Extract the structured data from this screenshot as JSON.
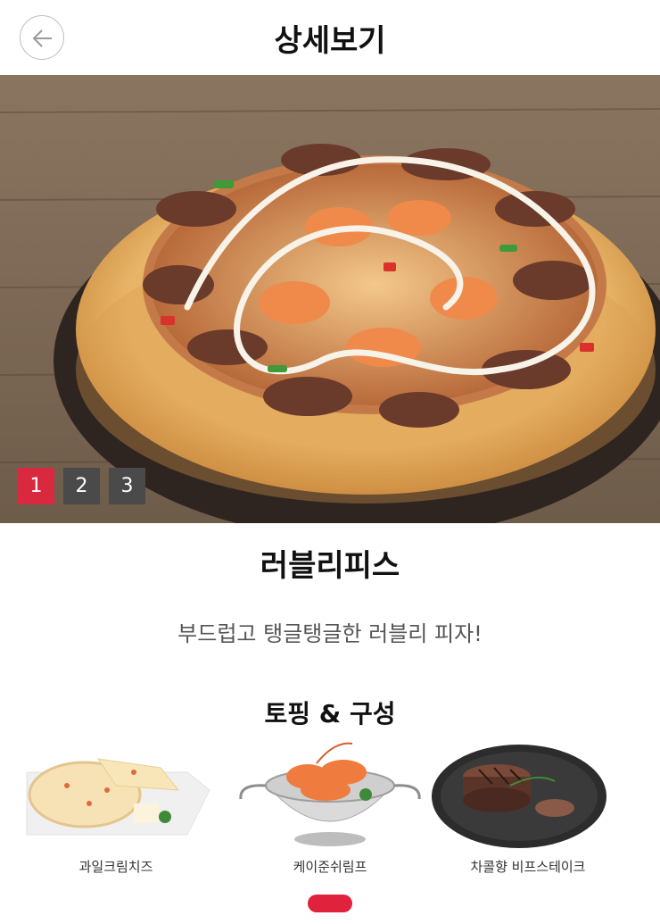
{
  "header": {
    "title": "상세보기",
    "back_icon": "arrow-left-icon"
  },
  "gallery": {
    "pages": [
      "1",
      "2",
      "3"
    ],
    "active_page": "1"
  },
  "product": {
    "name": "러블리피스",
    "description": "부드럽고 탱글탱글한 러블리 피자!"
  },
  "toppings": {
    "title": "토핑 & 구성",
    "items": [
      {
        "label": "과일크림치즈"
      },
      {
        "label": "케이준쉬림프"
      },
      {
        "label": "차콜향 비프스테이크"
      }
    ]
  },
  "colors": {
    "accent": "#d8293f",
    "pager_inactive": "#4a4a4a",
    "indicator": "#e0223c"
  }
}
